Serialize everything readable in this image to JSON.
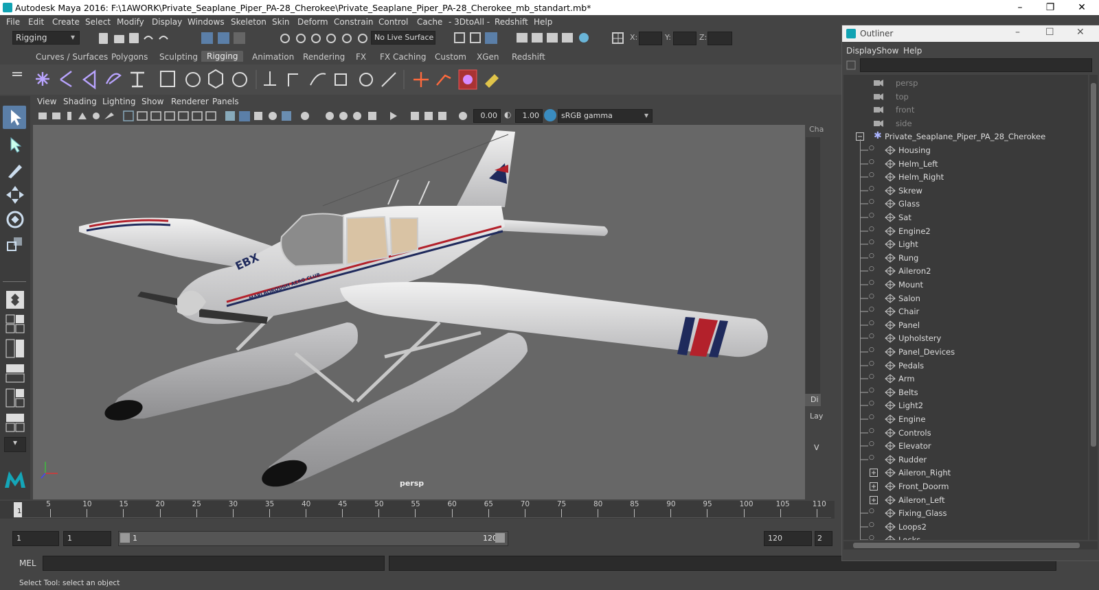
{
  "window": {
    "title": "Autodesk Maya 2016: F:\\1AWORK\\Private_Seaplane_Piper_PA-28_Cherokee\\Private_Seaplane_Piper_PA-28_Cherokee_mb_standart.mb*"
  },
  "menu": [
    "File",
    "Edit",
    "Create",
    "Select",
    "Modify",
    "Display",
    "Windows",
    "Skeleton",
    "Skin",
    "Deform",
    "Constrain",
    "Control",
    "Cache",
    "- 3DtoAll -",
    "Redshift",
    "Help"
  ],
  "status_line": {
    "menu_set": "Rigging",
    "live_surface": "No Live Surface",
    "x_label": "X:",
    "y_label": "Y:",
    "z_label": "Z:"
  },
  "shelf_tabs": [
    "Curves / Surfaces",
    "Polygons",
    "Sculpting",
    "Rigging",
    "Animation",
    "Rendering",
    "FX",
    "FX Caching",
    "Custom",
    "XGen",
    "Redshift"
  ],
  "active_shelf_tab": "Rigging",
  "panel_menu": [
    "View",
    "Shading",
    "Lighting",
    "Show",
    "Renderer",
    "Panels"
  ],
  "panel_toolbar": {
    "exposure": "0.00",
    "gamma": "1.00",
    "color_space": "sRGB gamma"
  },
  "viewport": {
    "camera_label": "persp",
    "tail_registration": "EBX",
    "fuselage_text": "MARLBOROUGH AERO CLUB",
    "accent_red": "#b3212b",
    "accent_blue": "#1f2a5c"
  },
  "side_panel": {
    "cha_label": "Cha",
    "di_label": "Di",
    "lay_label": "Lay",
    "v_label": "V"
  },
  "time_slider": {
    "ticks": [
      "5",
      "10",
      "15",
      "20",
      "25",
      "30",
      "35",
      "40",
      "45",
      "50",
      "55",
      "60",
      "65",
      "70",
      "75",
      "80",
      "85",
      "90",
      "95",
      "100",
      "105",
      "110"
    ],
    "current_frame": "1"
  },
  "range": {
    "start": "1",
    "anim_start": "1",
    "range_start_label": "1",
    "range_end_label": "120",
    "end": "120",
    "anim_end": "2"
  },
  "mel": {
    "label": "MEL"
  },
  "help_line": "Select Tool: select an object",
  "outliner": {
    "title": "Outliner",
    "menu": [
      "Display",
      "Show",
      "Help"
    ],
    "cameras": [
      "persp",
      "top",
      "front",
      "side"
    ],
    "root": "Private_Seaplane_Piper_PA_28_Cherokee",
    "children": [
      {
        "name": "Housing",
        "expandable": false
      },
      {
        "name": "Helm_Left",
        "expandable": false
      },
      {
        "name": "Helm_Right",
        "expandable": false
      },
      {
        "name": "Skrew",
        "expandable": false
      },
      {
        "name": "Glass",
        "expandable": false
      },
      {
        "name": "Sat",
        "expandable": false
      },
      {
        "name": "Engine2",
        "expandable": false
      },
      {
        "name": "Light",
        "expandable": false
      },
      {
        "name": "Rung",
        "expandable": false
      },
      {
        "name": "Aileron2",
        "expandable": false
      },
      {
        "name": "Mount",
        "expandable": false
      },
      {
        "name": "Salon",
        "expandable": false
      },
      {
        "name": "Chair",
        "expandable": false
      },
      {
        "name": "Panel",
        "expandable": false
      },
      {
        "name": "Upholstery",
        "expandable": false
      },
      {
        "name": "Panel_Devices",
        "expandable": false
      },
      {
        "name": "Pedals",
        "expandable": false
      },
      {
        "name": "Arm",
        "expandable": false
      },
      {
        "name": "Belts",
        "expandable": false
      },
      {
        "name": "Light2",
        "expandable": false
      },
      {
        "name": "Engine",
        "expandable": false
      },
      {
        "name": "Controls",
        "expandable": false
      },
      {
        "name": "Elevator",
        "expandable": false
      },
      {
        "name": "Rudder",
        "expandable": false
      },
      {
        "name": "Aileron_Right",
        "expandable": true
      },
      {
        "name": "Front_Doorm",
        "expandable": true
      },
      {
        "name": "Aileron_Left",
        "expandable": true
      },
      {
        "name": "Fixing_Glass",
        "expandable": false
      },
      {
        "name": "Loops2",
        "expandable": false
      },
      {
        "name": "Locks",
        "expandable": false
      }
    ]
  }
}
